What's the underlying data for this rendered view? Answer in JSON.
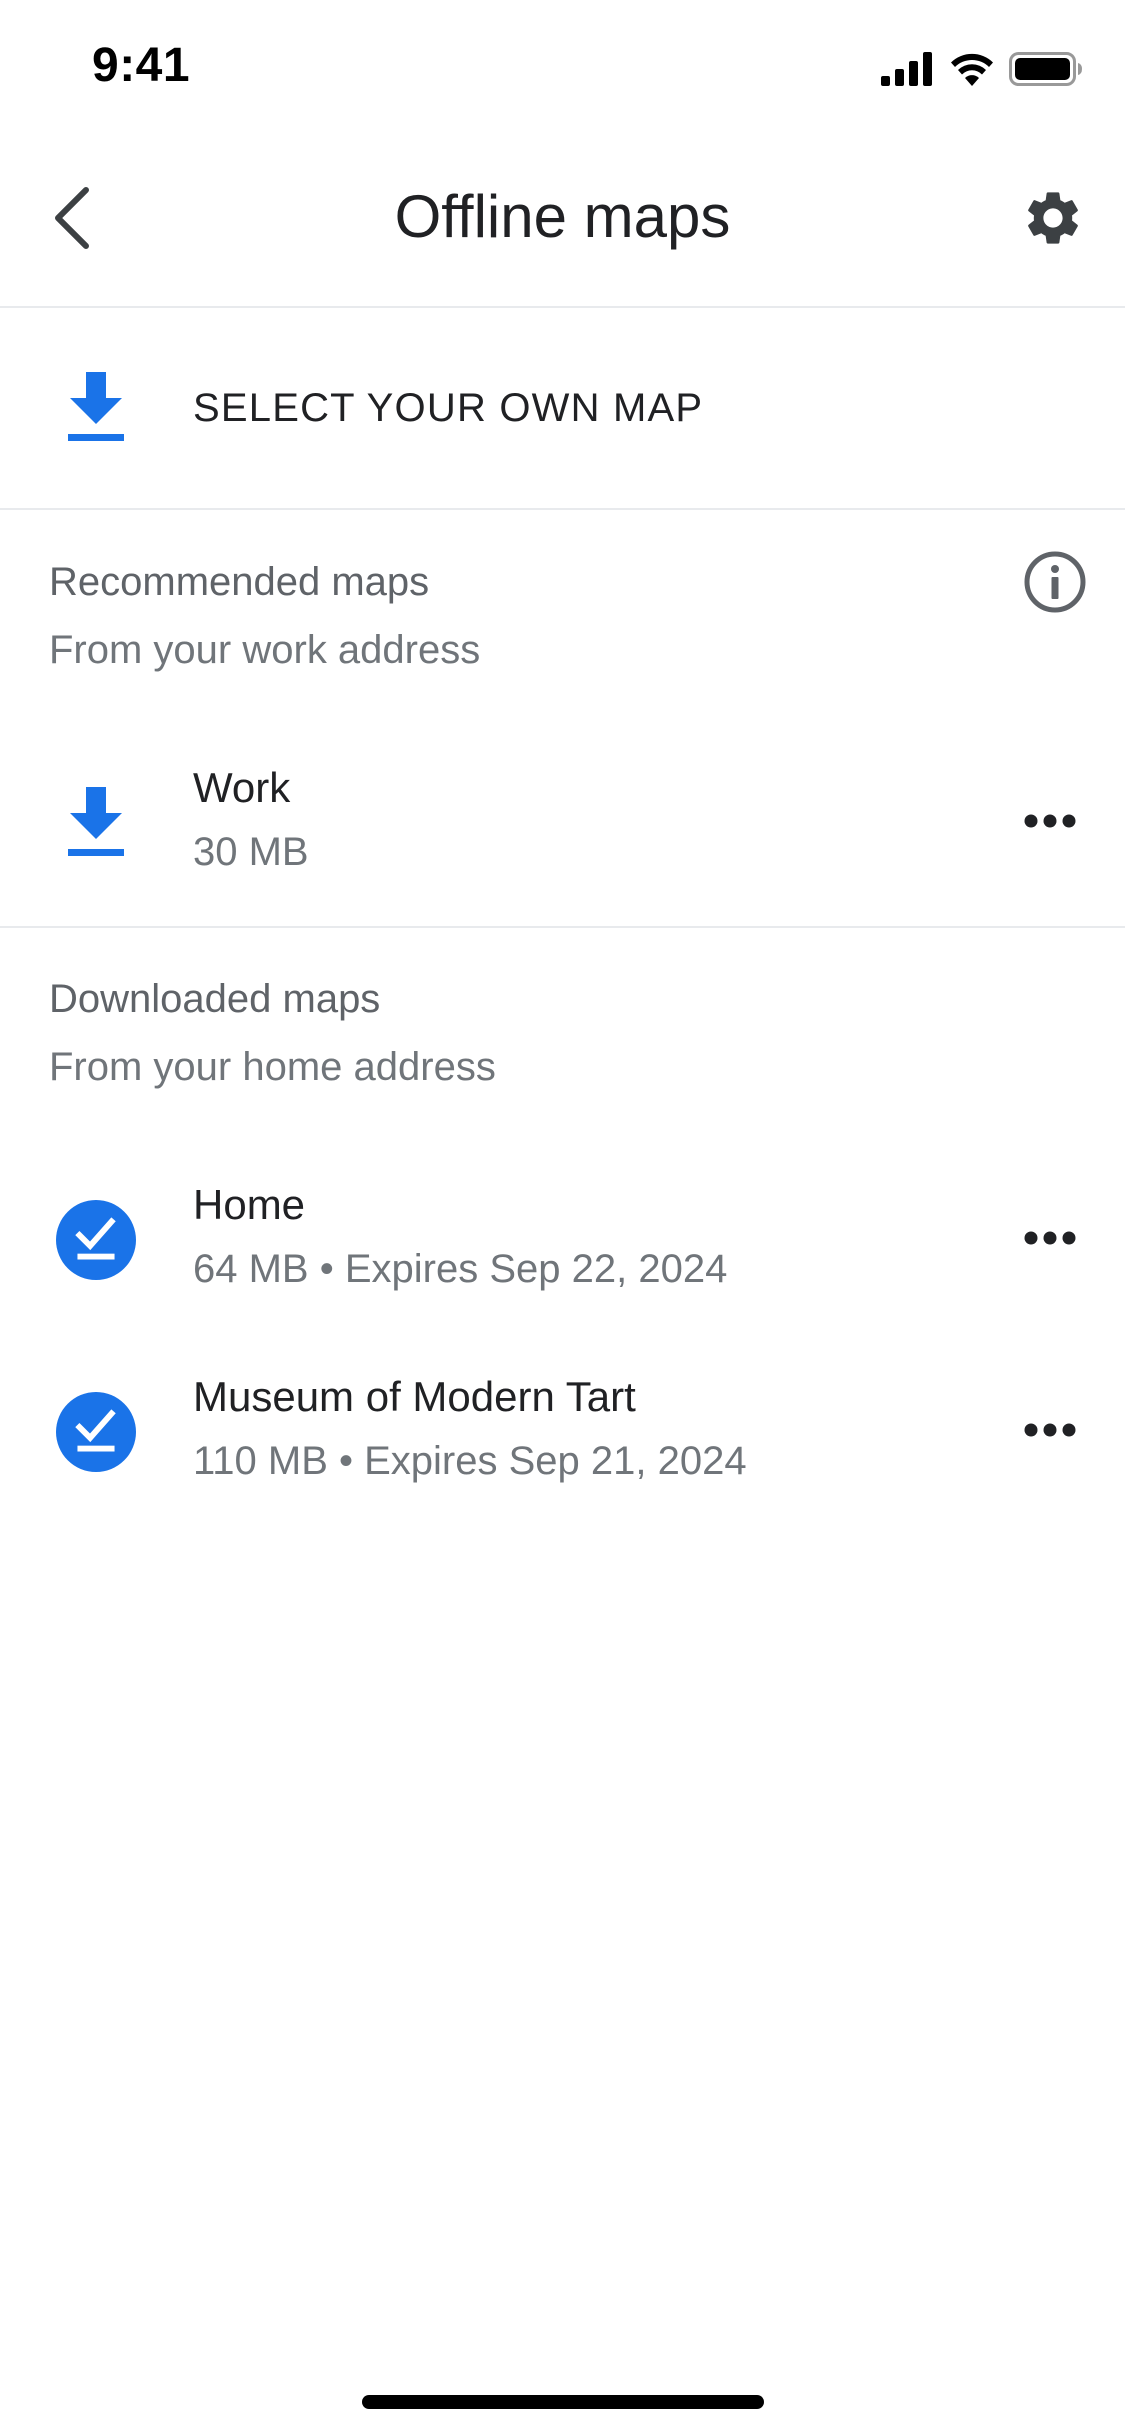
{
  "status_bar": {
    "time": "9:41",
    "icons": [
      "cellular-signal-icon",
      "wifi-icon",
      "battery-icon"
    ]
  },
  "header": {
    "title": "Offline maps",
    "back_icon": "chevron-left-icon",
    "settings_icon": "gear-icon"
  },
  "select_own_map": {
    "label": "SELECT YOUR OWN MAP",
    "icon": "download-icon"
  },
  "recommended": {
    "heading": "Recommended maps",
    "subheading": "From your work address",
    "info_icon": "info-icon",
    "items": [
      {
        "title": "Work",
        "meta": "30 MB",
        "icon": "download-icon"
      }
    ]
  },
  "downloaded": {
    "heading": "Downloaded maps",
    "subheading": "From your home address",
    "items": [
      {
        "title": "Home",
        "meta": "64 MB • Expires Sep 22, 2024",
        "icon": "downloaded-check-icon"
      },
      {
        "title": "Museum of Modern Tart",
        "meta": "110 MB • Expires Sep 21, 2024",
        "icon": "downloaded-check-icon"
      }
    ]
  },
  "colors": {
    "accent": "#1a73e8",
    "text_primary": "#202124",
    "text_secondary": "#70757a",
    "divider": "#e8eaed"
  }
}
